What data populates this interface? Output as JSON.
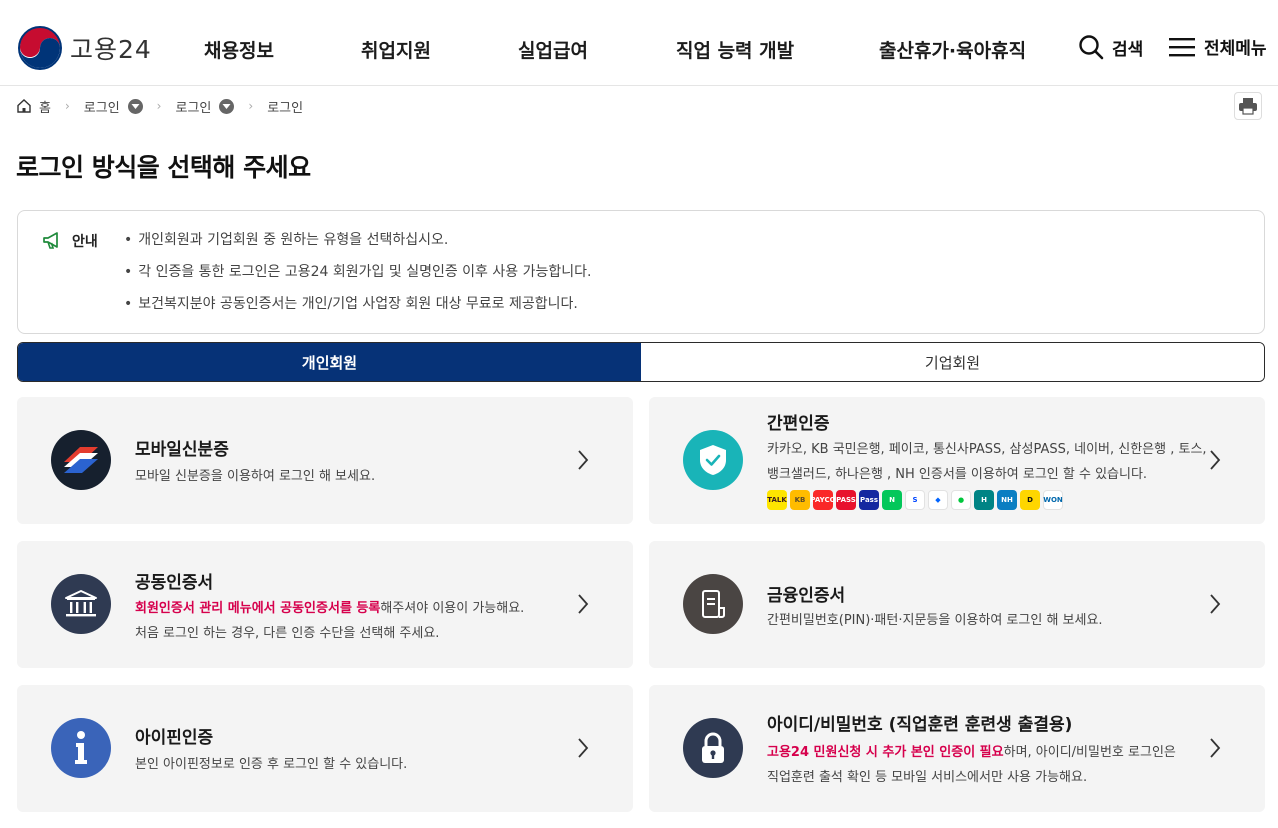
{
  "header": {
    "logo_text": "고용24",
    "nav": [
      "채용정보",
      "취업지원",
      "실업급여",
      "직업 능력 개발",
      "출산휴가·육아휴직"
    ],
    "search_label": "검색",
    "menu_label": "전체메뉴"
  },
  "breadcrumb": {
    "home": "홈",
    "items": [
      "로그인",
      "로그인",
      "로그인"
    ]
  },
  "page_title": "로그인 방식을 선택해 주세요",
  "notice": {
    "label": "안내",
    "items": [
      "개인회원과 기업회원 중 원하는 유형을 선택하십시오.",
      "각 인증을 통한 로그인은 고용24 회원가입 및 실명인증 이후 사용 가능합니다.",
      "보건복지분야 공동인증서는 개인/기업 사업장 회원 대상 무료로 제공합니다."
    ]
  },
  "tabs": [
    {
      "label": "개인회원",
      "active": true
    },
    {
      "label": "기업회원",
      "active": false
    }
  ],
  "cards": {
    "mobile_id": {
      "title": "모바일신분증",
      "desc": "모바일 신분증을 이용하여 로그인 해 보세요."
    },
    "simple_auth": {
      "title": "간편인증",
      "desc_line1": "카카오, KB 국민은행, 페이코, 통신사PASS, 삼성PASS, 네이버, 신한은행 , 토스,",
      "desc_line2": "뱅크샐러드, 하나은행 , NH 인증서를 이용하여 로그인 할 수 있습니다.",
      "providers": [
        {
          "name": "카카오",
          "mark": "TALK",
          "color": "#fee500",
          "text": "#3c1e1e"
        },
        {
          "name": "KB국민은행",
          "mark": "KB",
          "color": "#ffbc00",
          "text": "#5a4a2a"
        },
        {
          "name": "페이코",
          "mark": "PAYCO",
          "color": "#fa2828",
          "text": "#ffffff"
        },
        {
          "name": "통신사PASS",
          "mark": "PASS",
          "color": "#e8112d",
          "text": "#ffffff"
        },
        {
          "name": "삼성PASS",
          "mark": "Pass",
          "color": "#1428a0",
          "text": "#ffffff"
        },
        {
          "name": "네이버",
          "mark": "N",
          "color": "#03c75a",
          "text": "#ffffff"
        },
        {
          "name": "신한은행",
          "mark": "S",
          "color": "#ffffff",
          "text": "#0046ff"
        },
        {
          "name": "토스",
          "mark": "◆",
          "color": "#ffffff",
          "text": "#0064ff"
        },
        {
          "name": "뱅크샐러드",
          "mark": "●",
          "color": "#ffffff",
          "text": "#00c73c"
        },
        {
          "name": "하나은행",
          "mark": "H",
          "color": "#008485",
          "text": "#ffffff"
        },
        {
          "name": "NH",
          "mark": "NH",
          "color": "#0a7ec2",
          "text": "#ffffff"
        },
        {
          "name": "뱅크",
          "mark": "D",
          "color": "#ffd600",
          "text": "#111111"
        },
        {
          "name": "우리",
          "mark": "WON",
          "color": "#ffffff",
          "text": "#0067ac"
        }
      ]
    },
    "joint_cert": {
      "title": "공동인증서",
      "desc_highlight": "회원인증서 관리 메뉴에서 공동인증서를 등록",
      "desc_rest": "해주셔야 이용이 가능해요.",
      "desc_line2": "처음 로그인 하는 경우, 다른 인증 수단을 선택해 주세요."
    },
    "financial_cert": {
      "title": "금융인증서",
      "desc": "간편비밀번호(PIN)·패턴·지문등을 이용하여 로그인 해 보세요."
    },
    "ipin": {
      "title": "아이핀인증",
      "desc": "본인 아이핀정보로 인증 후 로그인 할 수 있습니다."
    },
    "id_pw": {
      "title": "아이디/비밀번호 (직업훈련 훈련생 출결용)",
      "desc_highlight": "고용24 민원신청 시 추가 본인 인증이 필요",
      "desc_rest": "하며, 아이디/비밀번호 로그인은",
      "desc_line2": "직업훈련 출석 확인 등 모바일 서비스에서만 사용 가능해요."
    }
  },
  "colors": {
    "primary": "#063277",
    "highlight": "#d6004c",
    "card_bg": "#f4f4f4",
    "teal": "#19b4b8",
    "dark_icon": "#2f3a52"
  }
}
